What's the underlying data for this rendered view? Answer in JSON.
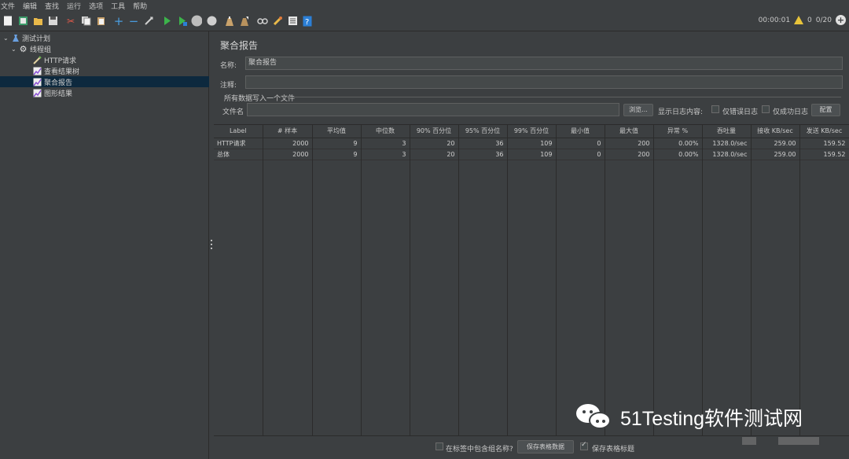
{
  "menu": [
    "文件",
    "编辑",
    "查找",
    "运行",
    "选项",
    "工具",
    "帮助"
  ],
  "toolbar": {
    "icons": [
      "new-icon",
      "templates-icon",
      "open-icon",
      "save-icon",
      "cut-icon",
      "copy-icon",
      "paste-icon",
      "expand-icon",
      "collapse-icon",
      "toggle-icon",
      "start-icon",
      "start-no-pause-icon",
      "stop-icon",
      "shutdown-icon",
      "clear-icon",
      "clear-all-icon",
      "search-icon",
      "reset-search-icon",
      "function-helper-icon",
      "help-icon"
    ],
    "timer": "00:00:01",
    "warnings": "0",
    "threads": "0/20"
  },
  "tree": [
    {
      "label": "测试计划",
      "icon": "test-plan-icon",
      "level": 0
    },
    {
      "label": "线程组",
      "icon": "thread-group-icon",
      "level": 1
    },
    {
      "label": "HTTP请求",
      "icon": "http-sampler-icon",
      "level": 2
    },
    {
      "label": "查看结果树",
      "icon": "listener-icon",
      "level": 2
    },
    {
      "label": "聚合报告",
      "icon": "listener-icon",
      "level": 2,
      "selected": true
    },
    {
      "label": "图形结果",
      "icon": "listener-icon",
      "level": 2
    }
  ],
  "panel": {
    "title": "聚合报告",
    "name_label": "名称:",
    "name_value": "聚合报告",
    "comment_label": "注释:",
    "comment_value": "",
    "file_group_title": "所有数据写入一个文件",
    "filename_label": "文件名",
    "filename_value": "",
    "browse_label": "浏览...",
    "log_display_label": "显示日志内容:",
    "errors_only_label": "仅错误日志",
    "success_only_label": "仅成功日志",
    "configure_label": "配置"
  },
  "table": {
    "columns": [
      "Label",
      "# 样本",
      "平均值",
      "中位数",
      "90% 百分位",
      "95% 百分位",
      "99% 百分位",
      "最小值",
      "最大值",
      "异常 %",
      "吞吐量",
      "接收 KB/sec",
      "发送 KB/sec"
    ],
    "rows": [
      [
        "HTTP请求",
        "2000",
        "9",
        "3",
        "20",
        "36",
        "109",
        "0",
        "200",
        "0.00%",
        "1328.0/sec",
        "259.00",
        "159.52"
      ],
      [
        "总体",
        "2000",
        "9",
        "3",
        "20",
        "36",
        "109",
        "0",
        "200",
        "0.00%",
        "1328.0/sec",
        "259.00",
        "159.52"
      ]
    ]
  },
  "bottom": {
    "include_group_label": "在标签中包含组名称?",
    "save_table_label": "保存表格数据",
    "save_header_label": "保存表格标题"
  },
  "watermark": {
    "text": "51Testing软件测试网"
  }
}
